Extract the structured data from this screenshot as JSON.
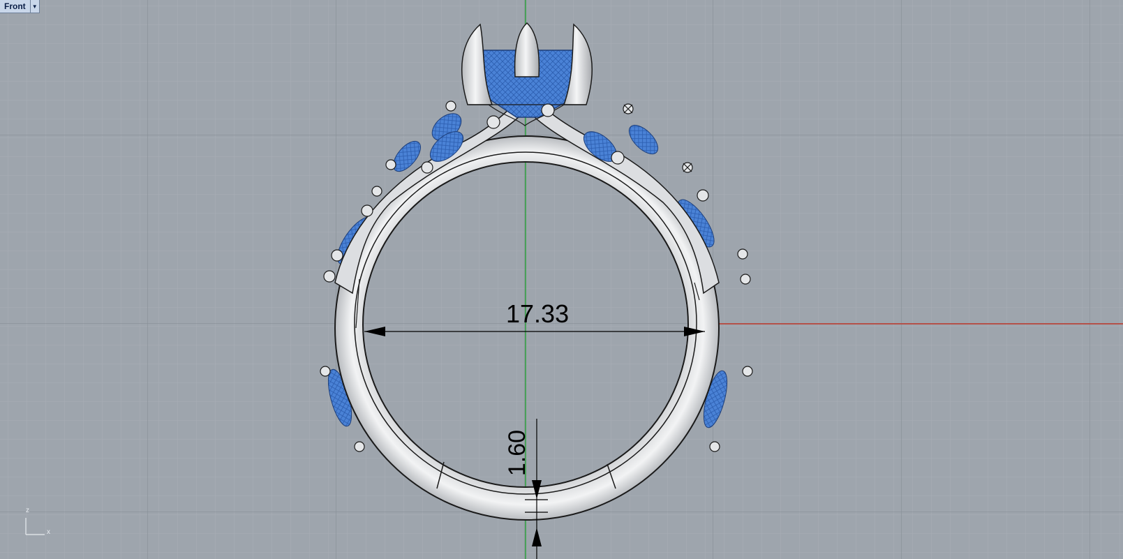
{
  "viewport": {
    "name": "Front",
    "menu_icon": "chevron-down-icon"
  },
  "dimensions": {
    "inner_diameter": "17.33",
    "shank_thickness": "1.60"
  },
  "axes": {
    "vertical_label": "z",
    "horizontal_label": "x"
  },
  "colors": {
    "background": "#9ea5ad",
    "grid_minor": "#a8aeb6",
    "grid_major": "#8c939b",
    "axis_x": "#c0392b",
    "axis_z": "#2e9e3e",
    "metal": "#e3e5e7",
    "gem": "#4a82d6"
  }
}
